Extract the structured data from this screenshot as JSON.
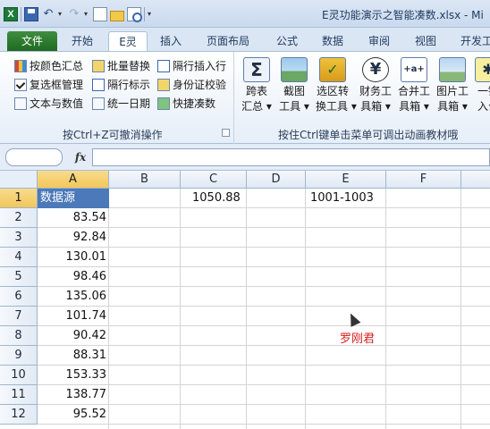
{
  "title_bar": {
    "window_title": "E灵功能演示之智能凑数.xlsx - Mi",
    "quick_access": [
      "excel-logo-icon",
      "save-icon",
      "undo-icon",
      "redo-icon",
      "new-document-icon",
      "open-folder-icon",
      "print-preview-icon"
    ]
  },
  "ribbon_tabs": [
    {
      "label": "文件"
    },
    {
      "label": "开始"
    },
    {
      "label": "E灵"
    },
    {
      "label": "插入"
    },
    {
      "label": "页面布局"
    },
    {
      "label": "公式"
    },
    {
      "label": "数据"
    },
    {
      "label": "审阅"
    },
    {
      "label": "视图"
    },
    {
      "label": "开发工"
    }
  ],
  "ribbon": {
    "group1": {
      "row1": [
        "按颜色汇总",
        "批量替换",
        "隔行插入行"
      ],
      "row2": [
        "复选框管理",
        "隔行标示",
        "身份证校验"
      ],
      "row3": [
        "文本与数值",
        "统一日期",
        "快捷凑数"
      ],
      "label": "按Ctrl+Z可撤消操作"
    },
    "group2": {
      "buttons": [
        {
          "line1": "跨表",
          "line2": "汇总 ▾",
          "icon": "sigma-icon"
        },
        {
          "line1": "截图",
          "line2": "工具 ▾",
          "icon": "screenshot-icon"
        },
        {
          "line1": "选区转",
          "line2": "换工具 ▾",
          "icon": "convert-icon"
        },
        {
          "line1": "财务工",
          "line2": "具箱 ▾",
          "icon": "yen-icon"
        },
        {
          "line1": "合并工",
          "line2": "具箱 ▾",
          "icon": "merge-icon"
        },
        {
          "line1": "图片工",
          "line2": "具箱 ▾",
          "icon": "image-icon"
        },
        {
          "line1": "一键",
          "line2": "入公",
          "icon": "formula-icon"
        }
      ],
      "label": "按住Ctrl键单击菜单可调出动画教材哦"
    }
  },
  "formula_bar": {
    "fx_label": "fx",
    "name_box": "",
    "formula": ""
  },
  "sheet": {
    "columns": [
      "A",
      "B",
      "C",
      "D",
      "E",
      "F"
    ],
    "rows": [
      "1",
      "2",
      "3",
      "4",
      "5",
      "6",
      "7",
      "8",
      "9",
      "10",
      "11",
      "12"
    ],
    "A": [
      "数据源",
      "83.54",
      "92.84",
      "130.01",
      "98.46",
      "135.06",
      "101.74",
      "90.42",
      "88.31",
      "153.33",
      "138.77",
      "95.52"
    ],
    "C1": "1050.88",
    "E1": "1001-1003",
    "signature": "罗刚君"
  }
}
